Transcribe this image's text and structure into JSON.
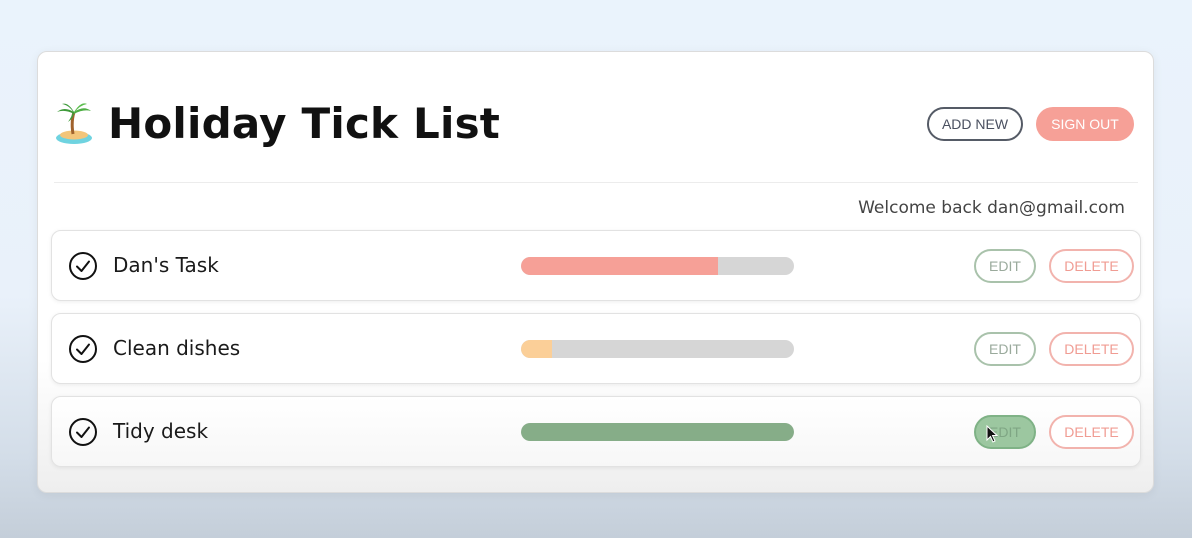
{
  "app": {
    "title": "Holiday Tick List",
    "logo_icon": "desert-island-icon"
  },
  "header": {
    "add_new_label": "ADD NEW",
    "sign_out_label": "SIGN OUT"
  },
  "welcome_text": "Welcome back dan@gmail.com",
  "tasks": [
    {
      "name": "Dan's Task",
      "progress": 0.72,
      "color": "#f6a097",
      "edit_label": "EDIT",
      "delete_label": "DELETE"
    },
    {
      "name": "Clean dishes",
      "progress": 0.115,
      "color": "#fbcf98",
      "edit_label": "EDIT",
      "delete_label": "DELETE"
    },
    {
      "name": "Tidy desk",
      "progress": 1.0,
      "color": "#86ad88",
      "edit_label": "EDIT",
      "delete_label": "DELETE"
    }
  ],
  "colors": {
    "accent": "#f6a097",
    "success": "#86ad88",
    "warning": "#fbcf98"
  }
}
